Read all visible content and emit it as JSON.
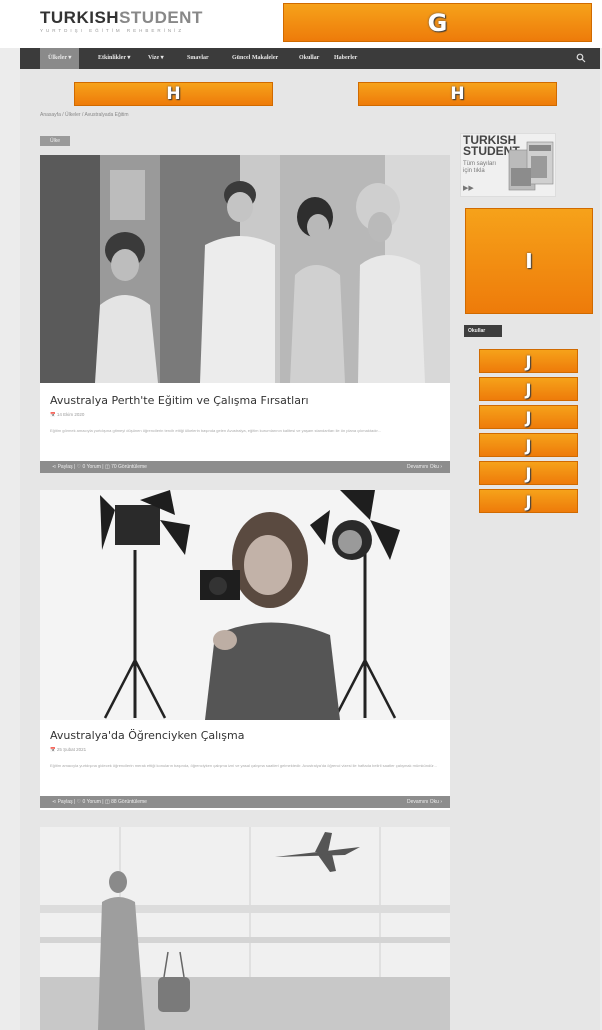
{
  "header": {
    "logo_main": "TURKISH",
    "logo_second": "STUDENT",
    "logo_sub": "YURTDIŞI EĞİTİM REHBERİNİZ"
  },
  "markers": {
    "g": "G",
    "h1": "H",
    "h2": "H",
    "i": "I",
    "j": [
      "J",
      "J",
      "J",
      "J",
      "J",
      "J"
    ]
  },
  "nav": {
    "items": [
      {
        "label": "Ülkeler ▾"
      },
      {
        "label": "Etkinlikler ▾"
      },
      {
        "label": "Vize ▾"
      },
      {
        "label": "Sınavlar"
      },
      {
        "label": "Güncel Makaleler"
      },
      {
        "label": "Okullar"
      },
      {
        "label": "Haberler"
      }
    ],
    "search_icon": "search-icon"
  },
  "breadcrumb": "Anasayfa  /  Ülkeler  /  Avustralyada Eğitim",
  "category_tag": "Ülke",
  "posts": [
    {
      "title": "Avustralya Perth'te Eğitim ve Çalışma Fırsatları",
      "date": "📅 14 Ekim 2020",
      "excerpt": "Eğitim görmek amacıyla yurtdışına gitmeyi düşünen öğrencilerin tercih ettiği ülkelerin başında gelen Avustralya, eğitim kurumlarının kalitesi ve yaşam standartları ile ön plana çıkmaktadır...",
      "share": "⋖ Paylaş  |  ♡ 0 Yorum  |  ◫ 70 Görüntüleme",
      "continue": "Devamını Oku ›"
    },
    {
      "title": "Avustralya'da Öğrenciyken Çalışma",
      "date": "📅 25 Şubat 2021",
      "excerpt": "Eğitim amacıyla yurtdışına gidecek öğrencilerin merak ettiği konuların başında, öğrenciyken çalışma izni ve yasal çalışma saatleri gelmektedir. Avustralya'da öğrenci vizesi ile haftada belirli saatler çalışmak mümkündür...",
      "share": "⋖ Paylaş  |  ♡ 0 Yorum  |  ◫ 88 Görüntüleme",
      "continue": "Devamını Oku ›"
    }
  ],
  "sidebar": {
    "ad": {
      "title_line1": "TURKISH",
      "title_line2": "STUDENT",
      "text_line1": "Tüm sayıları",
      "text_line2": "için tıkla",
      "arrow": "▶▶"
    },
    "widget_title": "Okullar"
  }
}
